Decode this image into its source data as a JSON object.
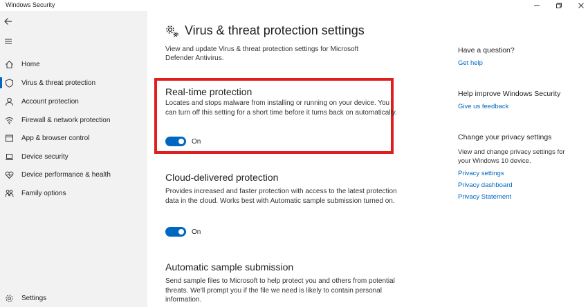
{
  "window": {
    "title": "Windows Security",
    "controls": {
      "minimize": "—",
      "maximize": "❐",
      "close": "✕"
    }
  },
  "sidebar": {
    "items": [
      {
        "label": "Home",
        "icon": "home-icon"
      },
      {
        "label": "Virus & threat protection",
        "icon": "shield-icon",
        "active": true
      },
      {
        "label": "Account protection",
        "icon": "person-icon"
      },
      {
        "label": "Firewall & network protection",
        "icon": "wifi-icon"
      },
      {
        "label": "App & browser control",
        "icon": "app-window-icon"
      },
      {
        "label": "Device security",
        "icon": "laptop-icon"
      },
      {
        "label": "Device performance & health",
        "icon": "heart-icon"
      },
      {
        "label": "Family options",
        "icon": "family-icon"
      }
    ],
    "settings_label": "Settings"
  },
  "main": {
    "title": "Virus & threat protection settings",
    "description": "View and update Virus & threat protection settings for Microsoft Defender Antivirus.",
    "sections": [
      {
        "title": "Real-time protection",
        "description": "Locates and stops malware from installing or running on your device. You can turn off this setting for a short time before it turns back on automatically.",
        "toggle_label": "On",
        "toggle_on": true
      },
      {
        "title": "Cloud-delivered protection",
        "description": "Provides increased and faster protection with access to the latest protection data in the cloud. Works best with Automatic sample submission turned on.",
        "toggle_label": "On",
        "toggle_on": true
      },
      {
        "title": "Automatic sample submission",
        "description": "Send sample files to Microsoft to help protect you and others from potential threats. We'll prompt you if the file we need is likely to contain personal information."
      }
    ]
  },
  "right": {
    "question_heading": "Have a question?",
    "get_help": "Get help",
    "improve_heading": "Help improve Windows Security",
    "feedback": "Give us feedback",
    "privacy_heading": "Change your privacy settings",
    "privacy_text": "View and change privacy settings for your Windows 10 device.",
    "privacy_settings": "Privacy settings",
    "privacy_dashboard": "Privacy dashboard",
    "privacy_statement": "Privacy Statement"
  },
  "colors": {
    "accent": "#0067c0",
    "highlight_border": "#e01e1e",
    "sidebar_bg": "#f2f2f2"
  }
}
